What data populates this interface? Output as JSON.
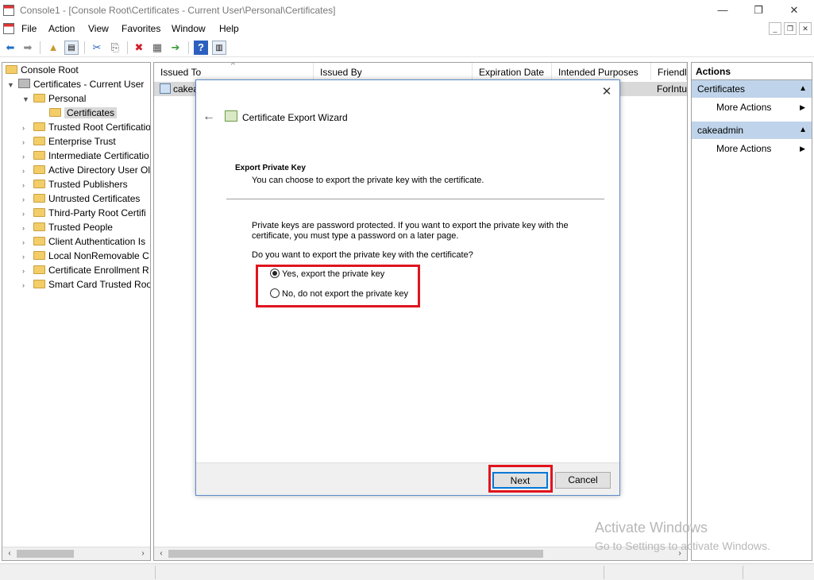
{
  "window": {
    "title": "Console1 - [Console Root\\Certificates - Current User\\Personal\\Certificates]",
    "minimize": "—",
    "restore": "❐",
    "close": "✕"
  },
  "menu": {
    "items": [
      "File",
      "Action",
      "View",
      "Favorites",
      "Window",
      "Help"
    ],
    "mdi_min": "_",
    "mdi_restore": "❐",
    "mdi_close": "✕"
  },
  "toolbar": {
    "icons": [
      "back-arrow-icon",
      "forward-arrow-icon",
      "up-folder-icon",
      "show-hide-tree-icon",
      "cut-icon",
      "copy-icon",
      "delete-icon",
      "properties-icon",
      "export-list-icon",
      "help-icon",
      "show-hide-action-pane-icon"
    ]
  },
  "tree": {
    "root": "Console Root",
    "certs_root": "Certificates - Current User",
    "personal": "Personal",
    "certificates": "Certificates",
    "stores": [
      "Trusted Root Certificatio",
      "Enterprise Trust",
      "Intermediate Certificatio",
      "Active Directory User Ol",
      "Trusted Publishers",
      "Untrusted Certificates",
      "Third-Party Root Certifi",
      "Trusted People",
      "Client Authentication Is",
      "Local NonRemovable C",
      "Certificate Enrollment R",
      "Smart Card Trusted Roo"
    ]
  },
  "list": {
    "columns": [
      "Issued To",
      "Issued By",
      "Expiration Date",
      "Intended Purposes",
      "Friendl"
    ],
    "row": {
      "issued_to": "cakea",
      "friendly": "ForIntu"
    }
  },
  "actions": {
    "header": "Actions",
    "sections": [
      {
        "title": "Certificates",
        "item": "More Actions"
      },
      {
        "title": "cakeadmin",
        "item": "More Actions"
      }
    ]
  },
  "wizard": {
    "title": "Certificate Export Wizard",
    "close": "✕",
    "back": "←",
    "section_heading": "Export Private Key",
    "section_desc": "You can choose to export the private key with the certificate.",
    "para1": "Private keys are password protected. If you want to export the private key with the certificate, you must type a password on a later page.",
    "question": "Do you want to export the private key with the certificate?",
    "option_yes": "Yes, export the private key",
    "option_no": "No, do not export the private key",
    "selected_option": "yes",
    "next_label": "Next",
    "cancel_label": "Cancel"
  },
  "watermark": {
    "line1": "Activate Windows",
    "line2": "Go to Settings to activate Windows."
  },
  "colors": {
    "highlight_border": "#e0141e",
    "action_section_bg": "#bfd4ea",
    "dialog_border": "#5b8bc9"
  }
}
